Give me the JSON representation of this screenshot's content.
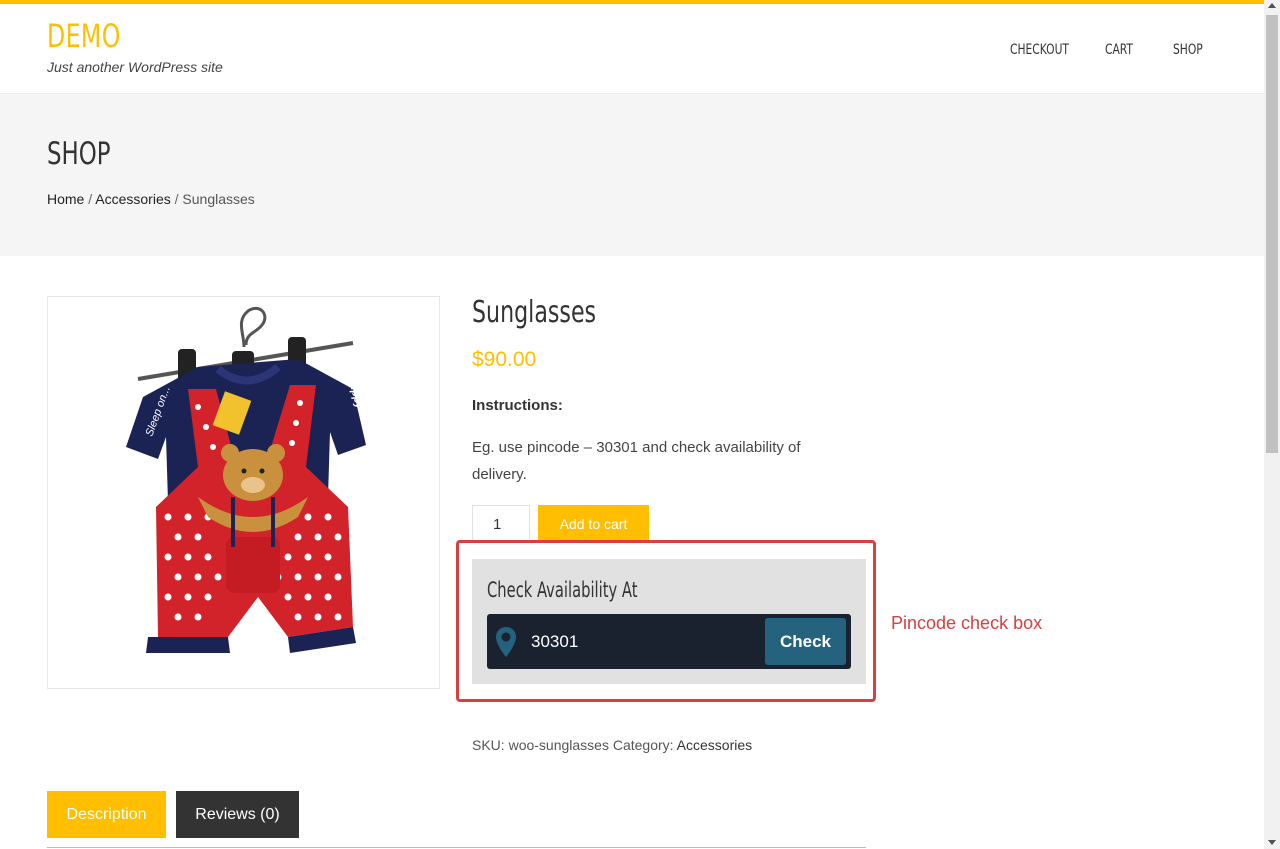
{
  "site": {
    "title": "DEMO",
    "description": "Just another WordPress site"
  },
  "nav": {
    "items": [
      {
        "label": "CHECKOUT"
      },
      {
        "label": "CART"
      },
      {
        "label": "SHOP"
      }
    ]
  },
  "page": {
    "title": "SHOP",
    "breadcrumb": {
      "home": "Home",
      "sep": " / ",
      "category": "Accessories",
      "current": "Sunglasses"
    }
  },
  "product": {
    "title": "Sunglasses",
    "price": "$90.00",
    "instructions_label": "Instructions:",
    "instructions_text": "Eg. use pincode – 30301 and check availability of delivery.",
    "quantity": "1",
    "add_to_cart_label": "Add to cart",
    "image_icon": "product-photo-baby-romper"
  },
  "availability": {
    "title": "Check Availability At",
    "pincode_value": "30301",
    "check_label": "Check",
    "icon": "location-pin-icon"
  },
  "annotation": {
    "label": "Pincode check box"
  },
  "meta": {
    "sku_label": "SKU: ",
    "sku_value": "woo-sunglasses",
    "category_label": " Category: ",
    "category_value": "Accessories"
  },
  "tabs": [
    {
      "label": "Description"
    },
    {
      "label": "Reviews (0)"
    }
  ],
  "colors": {
    "accent": "#ffbf00",
    "dark_button": "#24627e",
    "pin_bar": "#1a2230",
    "annotation_red": "#d64040",
    "tab_dark": "#333333"
  }
}
